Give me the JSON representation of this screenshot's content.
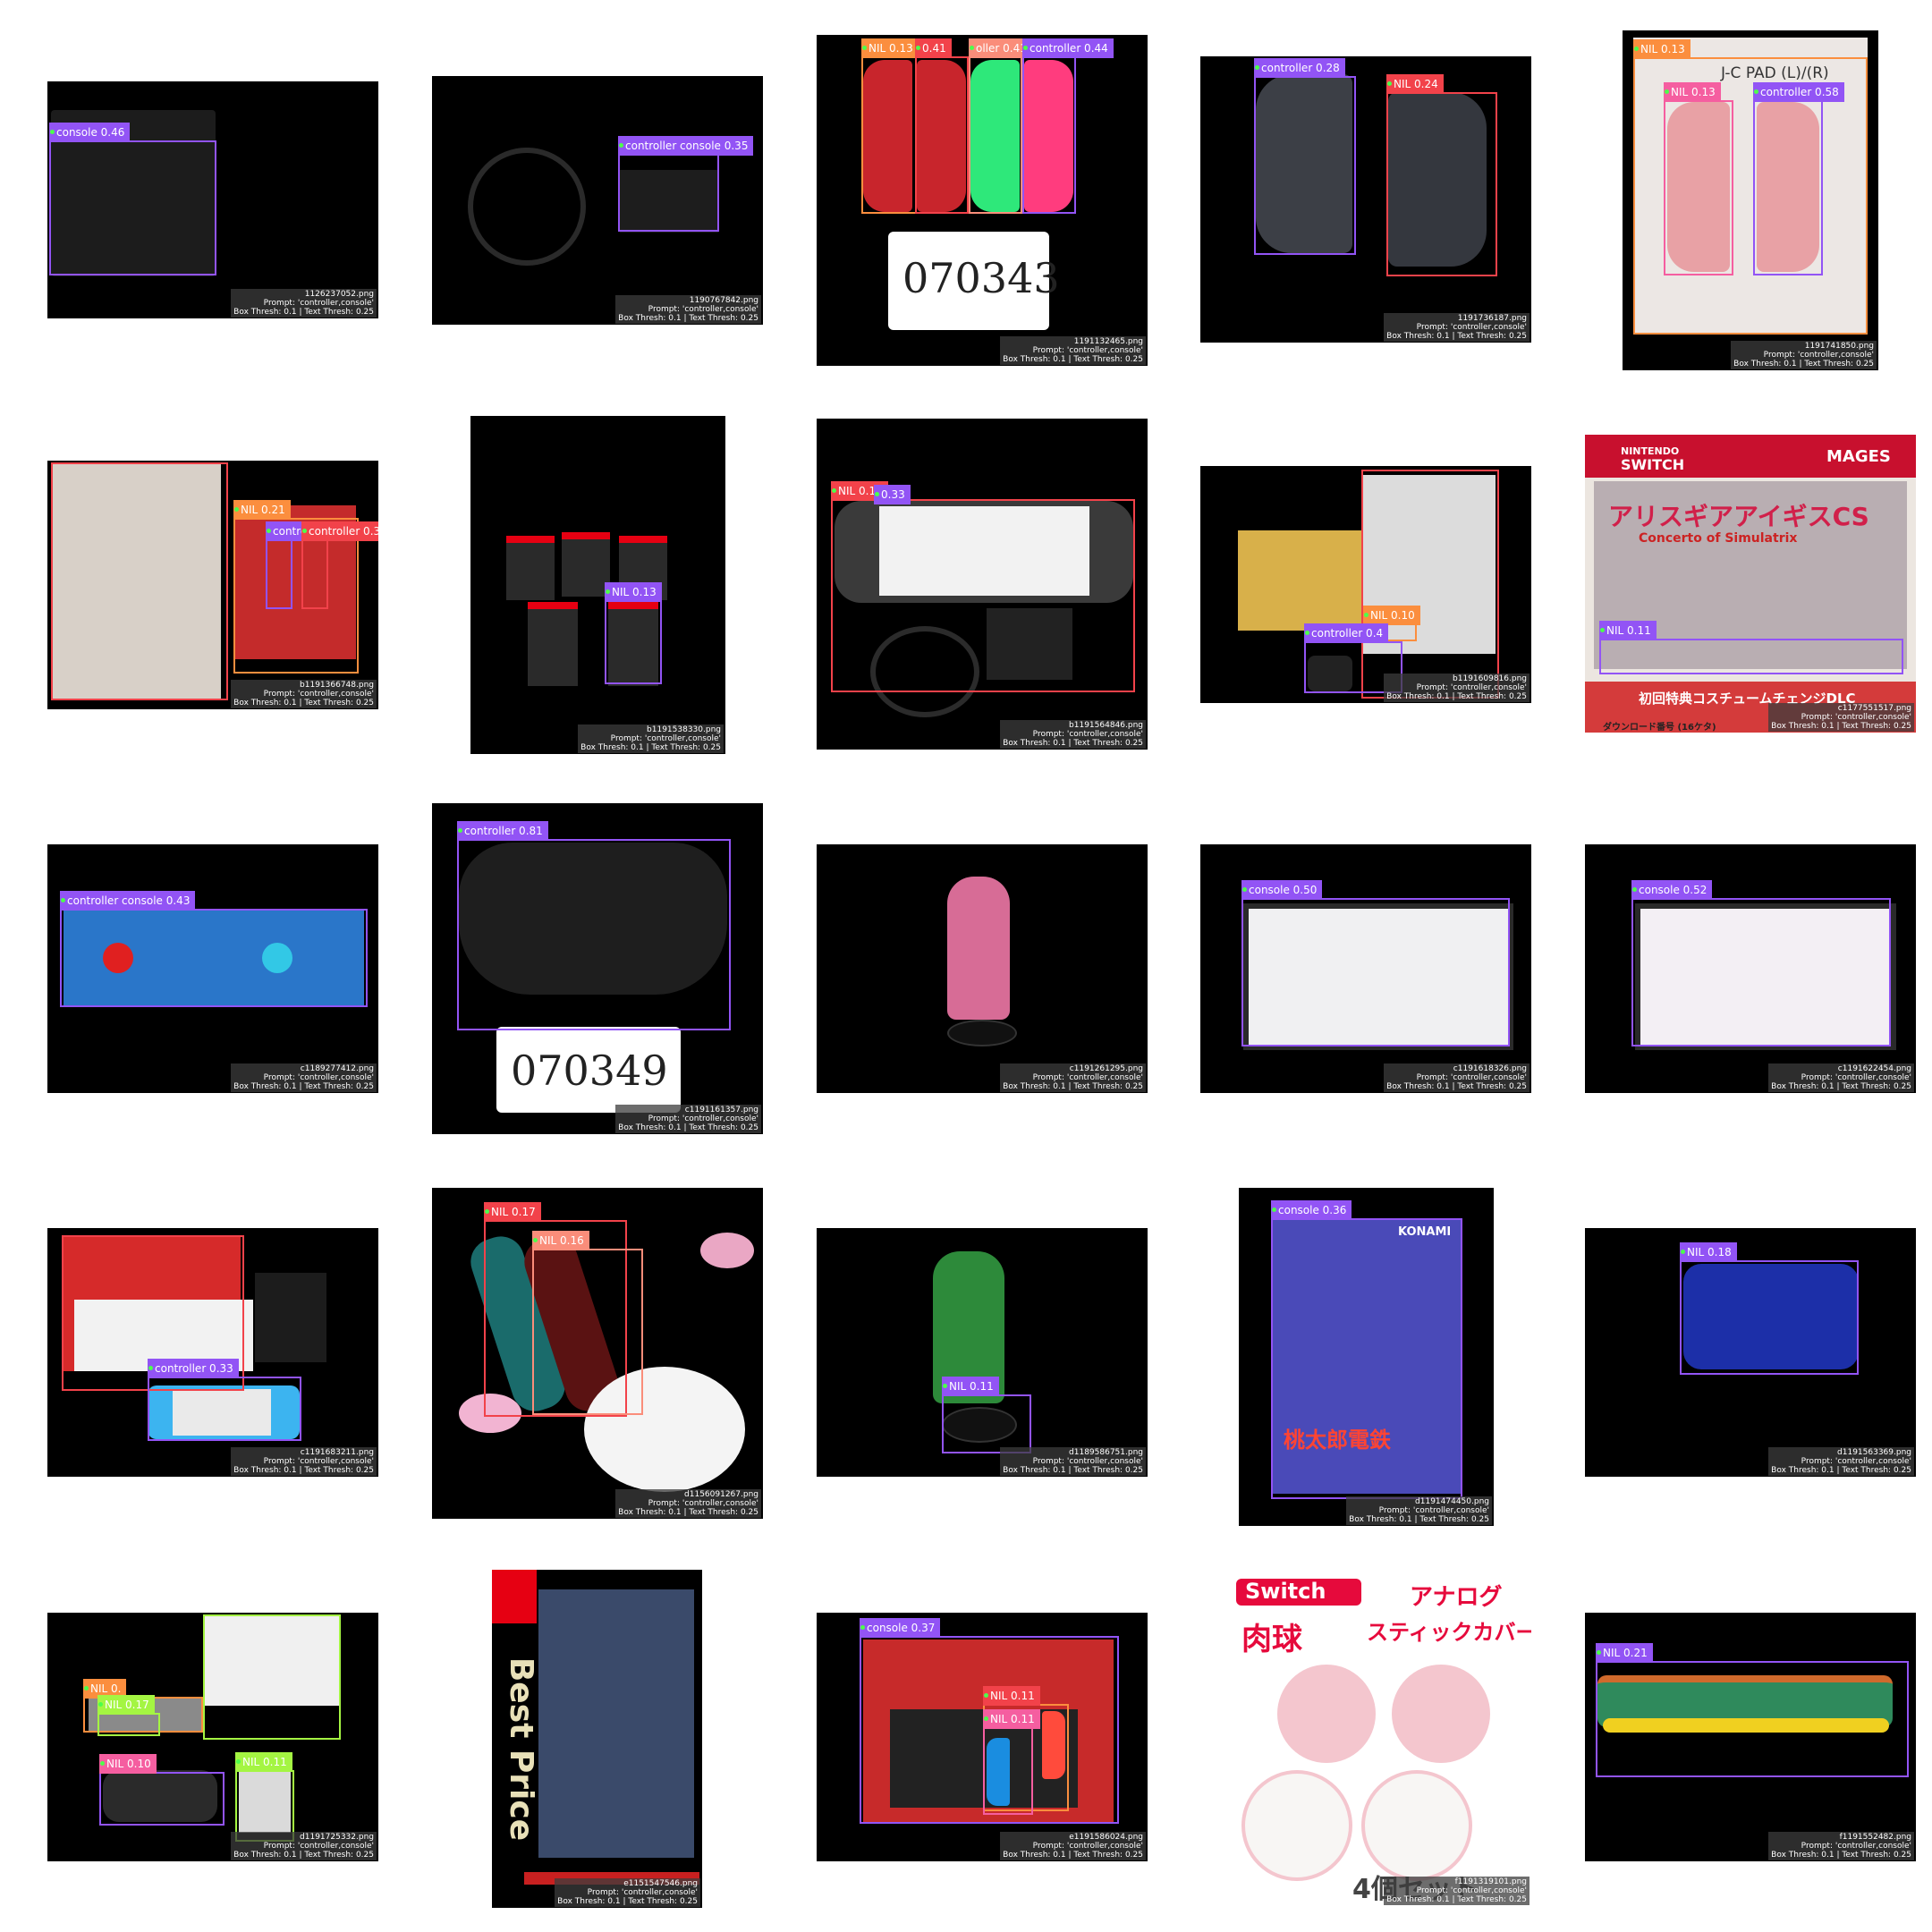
{
  "prompt_line": "Prompt: 'controller,console'",
  "thresh_line": "Box Thresh: 0.1 | Text Thresh: 0.25",
  "thresh_line_alt": "Box Thresh: 0.1 | Text Thresh: 0.25",
  "colors": {
    "purple": "#9254f5",
    "red": "#f2424a",
    "orange": "#fb8e3e",
    "green": "#3fd14a",
    "salmon": "#fa8d7a",
    "pink": "#f55ea0",
    "lime": "#a4f542"
  },
  "cells": [
    {
      "file": "1126237052.png",
      "labels": [
        "console 0.46"
      ]
    },
    {
      "file": "1190767842.png",
      "labels": [
        "controller console 0.35"
      ]
    },
    {
      "file": "1191132465.png",
      "labels": [
        "NIL 0.13",
        "0.41",
        "oller 0.41",
        "0.41",
        "controller 0.44"
      ],
      "sticker": "070343"
    },
    {
      "file": "1191736187.png",
      "labels": [
        "controller 0.28",
        "NIL 0.24"
      ]
    },
    {
      "file": "1191741850.png",
      "labels": [
        "NIL 0.13",
        "NIL 0.13",
        "0.56",
        "controller 0.58"
      ],
      "box_text": "J-C PAD (L)/(R)"
    },
    {
      "file": "b1191366748.png",
      "labels": [
        "NIL 0.21",
        "contro",
        "controller 0.34"
      ]
    },
    {
      "file": "b1191538330.png",
      "labels": [
        "NIL 0.13"
      ]
    },
    {
      "file": "b1191564846.png",
      "labels": [
        "NIL 0.13",
        "0.33"
      ]
    },
    {
      "file": "b1191609816.png",
      "labels": [
        "NIL 0.10",
        "controller 0.4",
        "0.11",
        ".11"
      ]
    },
    {
      "file": "c1177551517.png",
      "labels": [
        "NIL 0.11"
      ],
      "texts": [
        "NINTENDO",
        "SWITCH",
        "MAGES",
        "アリスギアアイギスCS",
        "Concerto of Simulatrix",
        "初回特典コスチュームチェンジDLC",
        "ダウンロード番号 (16ケタ)"
      ]
    },
    {
      "file": "c1189277412.png",
      "labels": [
        "controller console 0.43"
      ]
    },
    {
      "file": "c1191161357.png",
      "labels": [
        "controller 0.81"
      ],
      "sticker": "070349"
    },
    {
      "file": "c1191261295.png",
      "labels": []
    },
    {
      "file": "c1191618326.png",
      "labels": [
        "console 0.50"
      ]
    },
    {
      "file": "c1191622454.png",
      "labels": [
        "console 0.52"
      ]
    },
    {
      "file": "c1191683211.png",
      "labels": [
        "controller 0.33"
      ]
    },
    {
      "file": "d1156091267.png",
      "labels": [
        "NIL 0.17",
        "NIL 0.16"
      ]
    },
    {
      "file": "d1189586751.png",
      "labels": [
        "NIL 0.11"
      ]
    },
    {
      "file": "d1191474450.png",
      "labels": [
        "console 0.36"
      ],
      "texts": [
        "KONAMI",
        "桃太郎電鉄"
      ]
    },
    {
      "file": "d1191563369.png",
      "labels": [
        "NIL 0.18"
      ]
    },
    {
      "file": "d1191725332.png",
      "labels": [
        "NIL 0.",
        "NIL 0.17",
        "0.18",
        "NIL 0.10",
        "NIL 0.11"
      ]
    },
    {
      "file": "e1151547546.png",
      "labels": [],
      "texts": [
        "Best Price"
      ]
    },
    {
      "file": "e1191586024.png",
      "labels": [
        "console 0.37",
        "NIL 0.11",
        "NIL 0.11"
      ]
    },
    {
      "file": "f1191319101.png",
      "labels": [],
      "texts": [
        "Switch",
        "肉球",
        "アナログ",
        "スティックカバー",
        "4個セット"
      ]
    },
    {
      "file": "f1191552482.png",
      "labels": [
        "NIL 0.21"
      ]
    }
  ]
}
